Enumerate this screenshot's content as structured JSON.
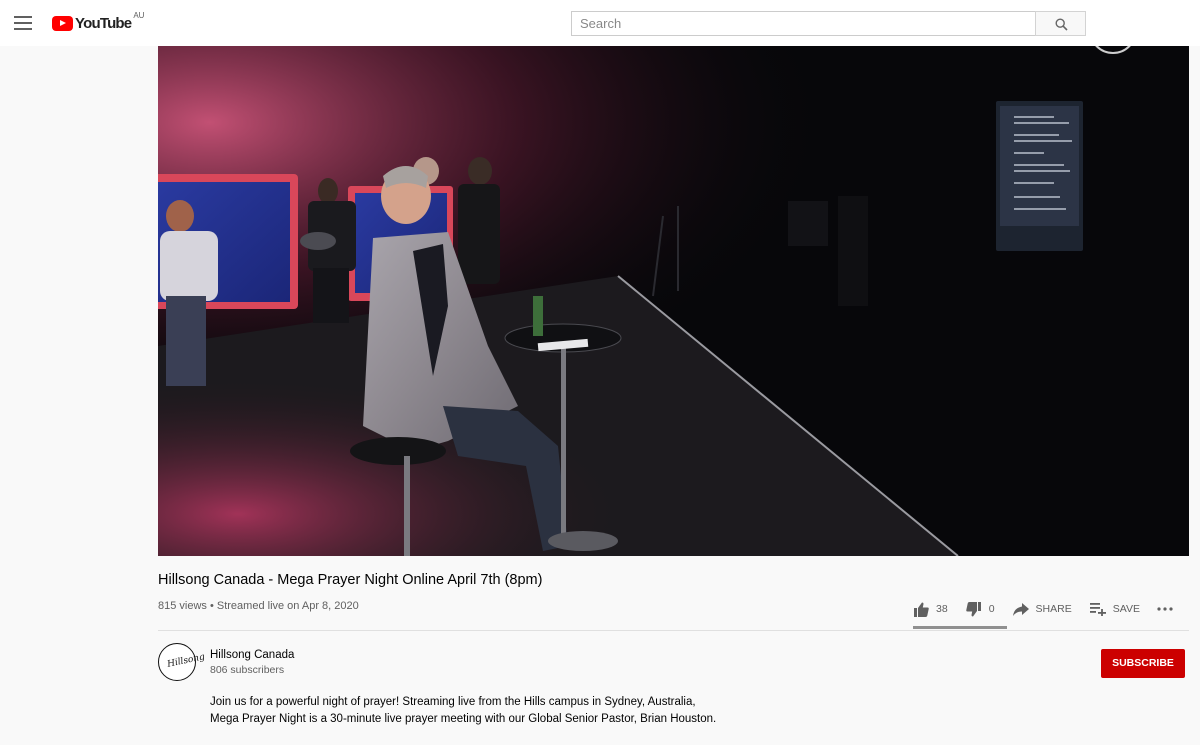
{
  "masthead": {
    "logo_text": "YouTube",
    "country_code": "AU",
    "search_placeholder": "Search"
  },
  "video": {
    "title": "Hillsong Canada - Mega Prayer Night Online April 7th (8pm)",
    "meta": "815 views • Streamed live on Apr 8, 2020",
    "likes": "38",
    "dislikes": "0",
    "share_label": "SHARE",
    "save_label": "SAVE",
    "like_ratio": 1.0
  },
  "channel": {
    "name": "Hillsong Canada",
    "subscribers": "806 subscribers",
    "avatar_mark": "Hillsong",
    "subscribe_label": "SUBSCRIBE"
  },
  "description": {
    "line1": "Join us for a powerful night of prayer! Streaming live from the Hills campus in Sydney, Australia,",
    "line2": "Mega Prayer Night is a 30-minute live prayer meeting with our Global Senior Pastor, Brian Houston."
  },
  "icons": {
    "menu": "hamburger-menu-icon",
    "search": "search-icon",
    "like": "thumbs-up-icon",
    "dislike": "thumbs-down-icon",
    "share": "share-arrow-icon",
    "save": "playlist-add-icon",
    "more": "more-horizontal-icon"
  },
  "colors": {
    "brand_red": "#ff0000",
    "subscribe_red": "#cc0000",
    "text_primary": "#030303",
    "text_secondary": "#606060"
  }
}
